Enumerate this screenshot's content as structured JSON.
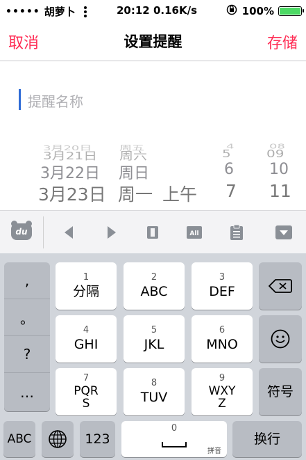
{
  "status": {
    "dots": "•••••",
    "carrier": "胡萝卜",
    "time_speed": "20:12 0.16K/s",
    "battery": "100%",
    "battery_level": 1.0
  },
  "nav": {
    "cancel": "取消",
    "title": "设置提醒",
    "save": "存储"
  },
  "name_field": {
    "placeholder": "提醒名称"
  },
  "picker": {
    "rows": [
      {
        "date": "3月20日",
        "weekday": "周五",
        "ampm": "",
        "hour": "4",
        "minute": "08"
      },
      {
        "date": "3月21日",
        "weekday": "周六",
        "ampm": "",
        "hour": "5",
        "minute": "09"
      },
      {
        "date": "3月22日",
        "weekday": "周日",
        "ampm": "",
        "hour": "6",
        "minute": "10"
      },
      {
        "date": "3月23日",
        "weekday": "周一",
        "ampm": "上午",
        "hour": "7",
        "minute": "11"
      }
    ]
  },
  "toolbar": {
    "logo": "du",
    "icons": [
      "baidu-logo-icon",
      "cursor-left-icon",
      "cursor-right-icon",
      "copy-icon",
      "select-all-icon",
      "clipboard-icon",
      "hide-keyboard-icon"
    ],
    "select_all": "All"
  },
  "keyboard": {
    "side": [
      ",",
      "。",
      "?",
      "…"
    ],
    "keys": [
      {
        "num": "1",
        "label": "分隔"
      },
      {
        "num": "2",
        "label": "ABC"
      },
      {
        "num": "3",
        "label": "DEF"
      },
      {
        "num": "4",
        "label": "GHI"
      },
      {
        "num": "5",
        "label": "JKL"
      },
      {
        "num": "6",
        "label": "MNO"
      },
      {
        "num": "7",
        "label": "PQR\nS"
      },
      {
        "num": "8",
        "label": "TUV"
      },
      {
        "num": "9",
        "label": "WXY\nZ"
      }
    ],
    "symbol": "符号",
    "abc": "ABC",
    "n123": "123",
    "space_num": "0",
    "pinyin": "拼音",
    "enter": "换行"
  }
}
